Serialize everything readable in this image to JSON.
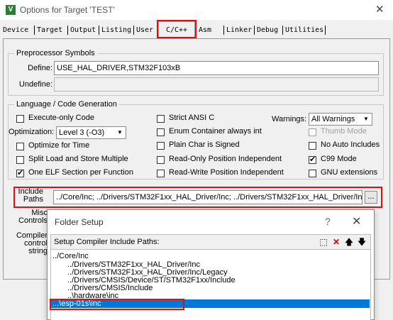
{
  "window": {
    "title": "Options for Target 'TEST'",
    "close_glyph": "✕",
    "icon_letter": "V"
  },
  "tabs": [
    "Device",
    "Target",
    "Output",
    "Listing",
    "User",
    "C/C++",
    "Asm",
    "Linker",
    "Debug",
    "Utilities"
  ],
  "preprocessor": {
    "group_title": "Preprocessor Symbols",
    "define_label": "Define:",
    "define_value": "USE_HAL_DRIVER,STM32F103xB",
    "undefine_label": "Undefine:",
    "undefine_value": ""
  },
  "language": {
    "group_title": "Language / Code Generation",
    "checkboxes": {
      "execute_only": "Execute-only Code",
      "optimize_time": "Optimize for Time",
      "split_load": "Split Load and Store Multiple",
      "one_elf": "One ELF Section per Function",
      "strict_ansi": "Strict ANSI C",
      "enum_container": "Enum Container always int",
      "plain_char": "Plain Char is Signed",
      "ro_pos": "Read-Only Position Independent",
      "rw_pos": "Read-Write Position Independent",
      "thumb_mode": "Thumb Mode",
      "no_auto": "No Auto Includes",
      "c99": "C99 Mode",
      "gnu_ext": "GNU extensions"
    },
    "optimization_label": "Optimization:",
    "optimization_value": "Level 3 (-O3)",
    "warnings_label": "Warnings:",
    "warnings_value": "All Warnings"
  },
  "include": {
    "label_line1": "Include",
    "label_line2": "Paths",
    "value": "../Core/Inc;      ../Drivers/STM32F1xx_HAL_Driver/Inc;      ../Drivers/STM32F1xx_HAL_Driver/Inc/",
    "browse": "..."
  },
  "misc": {
    "label_line1": "Misc",
    "label_line2": "Controls"
  },
  "compiler": {
    "label_line1": "Compiler",
    "label_line2": "control",
    "label_line3": "string"
  },
  "folder_dialog": {
    "title": "Folder Setup",
    "help_glyph": "?",
    "close_glyph": "✕",
    "header_label": "Setup Compiler Include Paths:",
    "tool_new": "⬚",
    "tool_delete": "✕",
    "tool_up": "🡅",
    "tool_down": "🡇",
    "paths": [
      "../Core/Inc",
      "../Drivers/STM32F1xx_HAL_Driver/Inc",
      "../Drivers/STM32F1xx_HAL_Driver/Inc/Legacy",
      "../Drivers/CMSIS/Device/ST/STM32F1xx/Include",
      "../Drivers/CMSIS/Include",
      "..\\hardware\\inc",
      "...\\esp-01s\\inc"
    ]
  },
  "colors": {
    "highlight_red": "#e01010",
    "selection_blue": "#0078d7",
    "icon_green": "#2e7d32"
  }
}
